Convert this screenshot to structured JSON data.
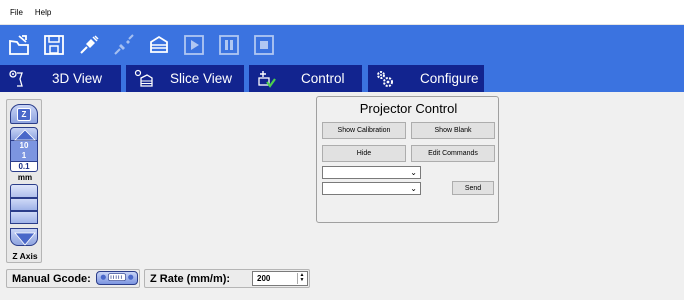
{
  "menu": {
    "items": [
      "File",
      "Help"
    ]
  },
  "toolbar": {
    "icons": [
      "open-folder-icon",
      "save-icon",
      "connect-icon",
      "disconnect-icon",
      "slice-icon",
      "play-icon",
      "pause-icon",
      "stop-icon"
    ]
  },
  "tabs": [
    {
      "label": "3D View",
      "icon": "eye-icon"
    },
    {
      "label": "Slice View",
      "icon": "layers-icon"
    },
    {
      "label": "Control",
      "icon": "control-icon"
    },
    {
      "label": "Configure",
      "icon": "gears-icon"
    }
  ],
  "zaxis": {
    "top_label": "Z",
    "steps": [
      "10",
      "1",
      "0.1"
    ],
    "selected_step": "0.1",
    "unit": "mm",
    "title": "Z Axis"
  },
  "projector": {
    "title": "Projector Control",
    "show_calibration": "Show Calibration",
    "show_blank": "Show Blank",
    "hide": "Hide",
    "edit_commands": "Edit Commands",
    "send": "Send"
  },
  "gcode": {
    "label": "Manual Gcode:",
    "rate_label": "Z Rate (mm/m):",
    "rate_value": "200"
  },
  "colors": {
    "toolbar_blue": "#3b73e0",
    "tab_navy": "#12248f"
  }
}
